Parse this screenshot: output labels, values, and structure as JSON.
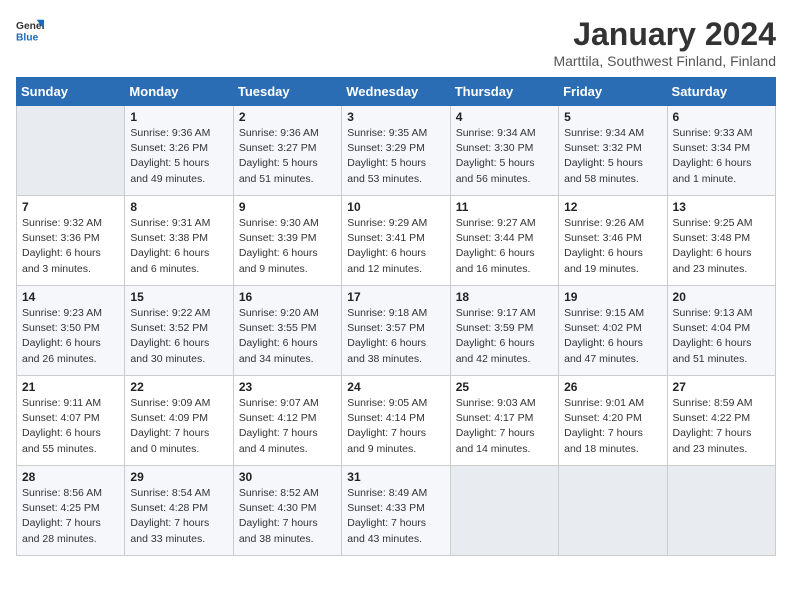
{
  "logo": {
    "general": "General",
    "blue": "Blue"
  },
  "title": "January 2024",
  "location": "Marttila, Southwest Finland, Finland",
  "headers": [
    "Sunday",
    "Monday",
    "Tuesday",
    "Wednesday",
    "Thursday",
    "Friday",
    "Saturday"
  ],
  "weeks": [
    [
      {
        "day": "",
        "info": ""
      },
      {
        "day": "1",
        "info": "Sunrise: 9:36 AM\nSunset: 3:26 PM\nDaylight: 5 hours\nand 49 minutes."
      },
      {
        "day": "2",
        "info": "Sunrise: 9:36 AM\nSunset: 3:27 PM\nDaylight: 5 hours\nand 51 minutes."
      },
      {
        "day": "3",
        "info": "Sunrise: 9:35 AM\nSunset: 3:29 PM\nDaylight: 5 hours\nand 53 minutes."
      },
      {
        "day": "4",
        "info": "Sunrise: 9:34 AM\nSunset: 3:30 PM\nDaylight: 5 hours\nand 56 minutes."
      },
      {
        "day": "5",
        "info": "Sunrise: 9:34 AM\nSunset: 3:32 PM\nDaylight: 5 hours\nand 58 minutes."
      },
      {
        "day": "6",
        "info": "Sunrise: 9:33 AM\nSunset: 3:34 PM\nDaylight: 6 hours\nand 1 minute."
      }
    ],
    [
      {
        "day": "7",
        "info": "Sunrise: 9:32 AM\nSunset: 3:36 PM\nDaylight: 6 hours\nand 3 minutes."
      },
      {
        "day": "8",
        "info": "Sunrise: 9:31 AM\nSunset: 3:38 PM\nDaylight: 6 hours\nand 6 minutes."
      },
      {
        "day": "9",
        "info": "Sunrise: 9:30 AM\nSunset: 3:39 PM\nDaylight: 6 hours\nand 9 minutes."
      },
      {
        "day": "10",
        "info": "Sunrise: 9:29 AM\nSunset: 3:41 PM\nDaylight: 6 hours\nand 12 minutes."
      },
      {
        "day": "11",
        "info": "Sunrise: 9:27 AM\nSunset: 3:44 PM\nDaylight: 6 hours\nand 16 minutes."
      },
      {
        "day": "12",
        "info": "Sunrise: 9:26 AM\nSunset: 3:46 PM\nDaylight: 6 hours\nand 19 minutes."
      },
      {
        "day": "13",
        "info": "Sunrise: 9:25 AM\nSunset: 3:48 PM\nDaylight: 6 hours\nand 23 minutes."
      }
    ],
    [
      {
        "day": "14",
        "info": "Sunrise: 9:23 AM\nSunset: 3:50 PM\nDaylight: 6 hours\nand 26 minutes."
      },
      {
        "day": "15",
        "info": "Sunrise: 9:22 AM\nSunset: 3:52 PM\nDaylight: 6 hours\nand 30 minutes."
      },
      {
        "day": "16",
        "info": "Sunrise: 9:20 AM\nSunset: 3:55 PM\nDaylight: 6 hours\nand 34 minutes."
      },
      {
        "day": "17",
        "info": "Sunrise: 9:18 AM\nSunset: 3:57 PM\nDaylight: 6 hours\nand 38 minutes."
      },
      {
        "day": "18",
        "info": "Sunrise: 9:17 AM\nSunset: 3:59 PM\nDaylight: 6 hours\nand 42 minutes."
      },
      {
        "day": "19",
        "info": "Sunrise: 9:15 AM\nSunset: 4:02 PM\nDaylight: 6 hours\nand 47 minutes."
      },
      {
        "day": "20",
        "info": "Sunrise: 9:13 AM\nSunset: 4:04 PM\nDaylight: 6 hours\nand 51 minutes."
      }
    ],
    [
      {
        "day": "21",
        "info": "Sunrise: 9:11 AM\nSunset: 4:07 PM\nDaylight: 6 hours\nand 55 minutes."
      },
      {
        "day": "22",
        "info": "Sunrise: 9:09 AM\nSunset: 4:09 PM\nDaylight: 7 hours\nand 0 minutes."
      },
      {
        "day": "23",
        "info": "Sunrise: 9:07 AM\nSunset: 4:12 PM\nDaylight: 7 hours\nand 4 minutes."
      },
      {
        "day": "24",
        "info": "Sunrise: 9:05 AM\nSunset: 4:14 PM\nDaylight: 7 hours\nand 9 minutes."
      },
      {
        "day": "25",
        "info": "Sunrise: 9:03 AM\nSunset: 4:17 PM\nDaylight: 7 hours\nand 14 minutes."
      },
      {
        "day": "26",
        "info": "Sunrise: 9:01 AM\nSunset: 4:20 PM\nDaylight: 7 hours\nand 18 minutes."
      },
      {
        "day": "27",
        "info": "Sunrise: 8:59 AM\nSunset: 4:22 PM\nDaylight: 7 hours\nand 23 minutes."
      }
    ],
    [
      {
        "day": "28",
        "info": "Sunrise: 8:56 AM\nSunset: 4:25 PM\nDaylight: 7 hours\nand 28 minutes."
      },
      {
        "day": "29",
        "info": "Sunrise: 8:54 AM\nSunset: 4:28 PM\nDaylight: 7 hours\nand 33 minutes."
      },
      {
        "day": "30",
        "info": "Sunrise: 8:52 AM\nSunset: 4:30 PM\nDaylight: 7 hours\nand 38 minutes."
      },
      {
        "day": "31",
        "info": "Sunrise: 8:49 AM\nSunset: 4:33 PM\nDaylight: 7 hours\nand 43 minutes."
      },
      {
        "day": "",
        "info": ""
      },
      {
        "day": "",
        "info": ""
      },
      {
        "day": "",
        "info": ""
      }
    ]
  ]
}
